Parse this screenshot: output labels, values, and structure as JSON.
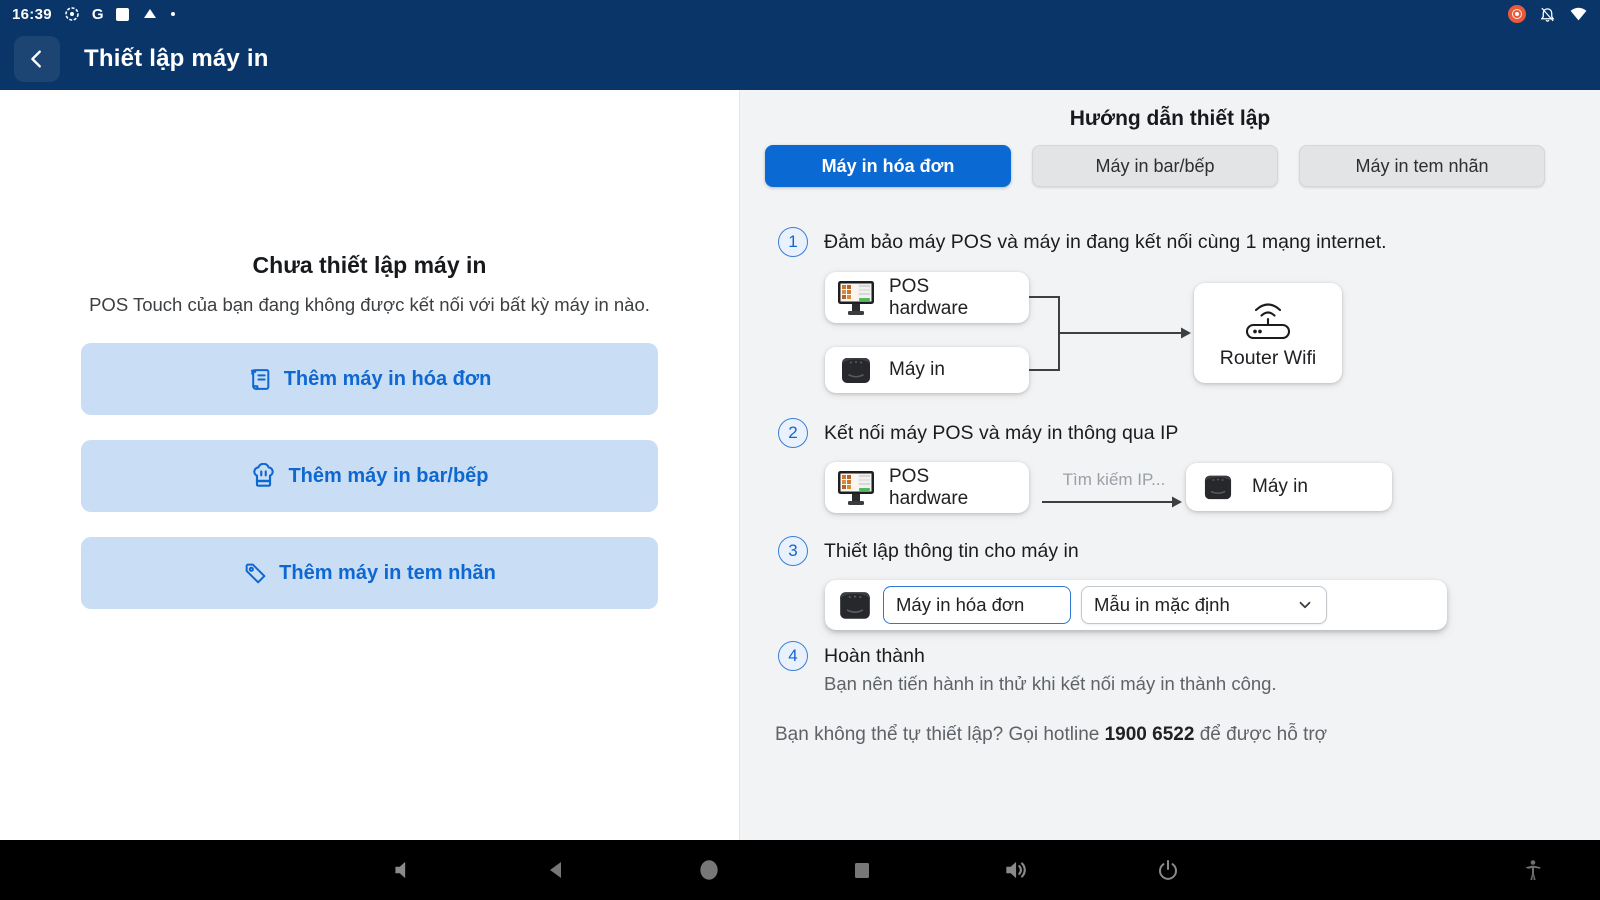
{
  "status_bar": {
    "time": "16:39",
    "left_icons": [
      "record-dot-icon",
      "google-g-icon",
      "white-square-icon",
      "upload-triangle-icon",
      "notification-dot-icon"
    ],
    "right_icons": [
      "screen-record-indicator",
      "notifications-off-icon",
      "wifi-calling-icon"
    ],
    "google_g": "G"
  },
  "app_bar": {
    "title": "Thiết lập máy in"
  },
  "left_panel": {
    "heading": "Chưa thiết lập máy in",
    "subheading": "POS Touch của bạn đang không được kết nối với bất kỳ máy in nào.",
    "buttons": [
      {
        "icon": "receipt-icon",
        "label": "Thêm máy in hóa đơn"
      },
      {
        "icon": "chef-hat-icon",
        "label": "Thêm máy in bar/bếp"
      },
      {
        "icon": "tag-icon",
        "label": "Thêm máy in tem nhãn"
      }
    ]
  },
  "right_panel": {
    "title": "Hướng dẫn thiết lập",
    "tabs": [
      {
        "label": "Máy in hóa đơn",
        "active": true
      },
      {
        "label": "Máy in bar/bếp",
        "active": false
      },
      {
        "label": "Máy in tem nhãn",
        "active": false
      }
    ],
    "steps": [
      {
        "number": "1",
        "text": "Đảm bảo máy POS và máy in đang kết nối cùng 1 mạng internet."
      },
      {
        "number": "2",
        "text": "Kết nối máy POS và máy in thông qua IP"
      },
      {
        "number": "3",
        "text": "Thiết lập thông tin cho máy in"
      },
      {
        "number": "4",
        "text": "Hoàn thành",
        "subtext": "Bạn nên tiến hành in thử khi kết nối máy in thành công."
      }
    ],
    "diagram1": {
      "pos_label": "POS hardware",
      "printer_label": "Máy in",
      "router_label": "Router Wifi"
    },
    "diagram2": {
      "pos_label": "POS hardware",
      "arrow_label": "Tìm kiếm IP...",
      "printer_label": "Máy in"
    },
    "step3_form": {
      "printer_name_value": "Máy in hóa đơn",
      "template_value": "Mẫu in mặc định"
    },
    "hotline": {
      "prefix": "Bạn không thể tự thiết lập? Gọi hotline ",
      "number": "1900 6522",
      "suffix": " để được hỗ trợ"
    }
  },
  "colors": {
    "header_navy": "#0a3568",
    "accent_blue": "#0b69d3",
    "light_blue_button": "#c9ddf4",
    "right_panel_bg": "#f1f3f5",
    "record_indicator": "#e85a3c",
    "muted_text": "#5f6368"
  }
}
